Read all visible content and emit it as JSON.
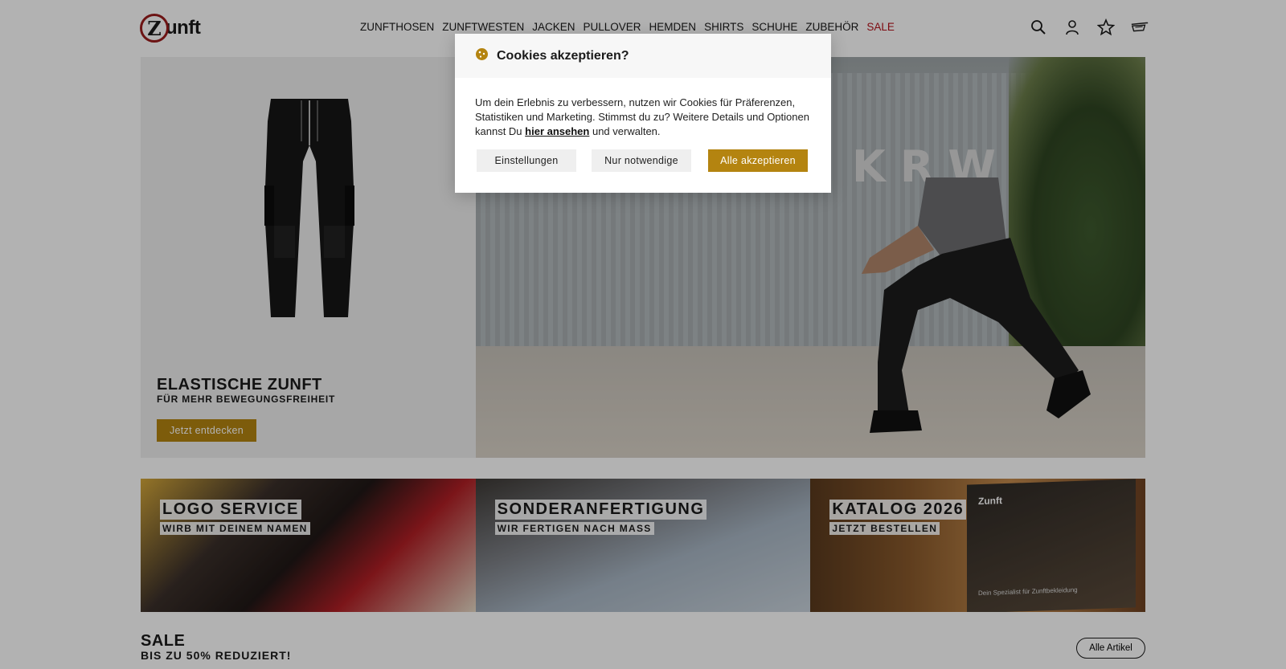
{
  "header": {
    "logo_letter": "Z",
    "logo_text": "unft",
    "nav": [
      "ZUNFTHOSEN",
      "ZUNFTWESTEN",
      "JACKEN",
      "PULLOVER",
      "HEMDEN",
      "SHIRTS",
      "SCHUHE",
      "ZUBEHÖR",
      "SALE"
    ],
    "icons": [
      "search-icon",
      "account-icon",
      "wishlist-icon",
      "cart-icon"
    ]
  },
  "hero": {
    "title": "ELASTISCHE ZUNFT",
    "subtitle": "FÜR MEHR BEWEGUNGSFREIHEIT",
    "button": "Jetzt entdecken",
    "building_text": "KRW"
  },
  "tiles": [
    {
      "title": "LOGO SERVICE",
      "subtitle": "WIRB MIT DEINEM NAMEN"
    },
    {
      "title": "SONDERANFERTIGUNG",
      "subtitle": "WIR FERTIGEN NACH MASS"
    },
    {
      "title": "KATALOG 2026",
      "subtitle": "JETZT BESTELLEN",
      "catalog_logo": "Zunft",
      "catalog_footer": "Dein Spezialist für Zunftbekleidung"
    }
  ],
  "sale": {
    "title": "SALE",
    "subtitle": "BIS ZU 50% REDUZIERT!",
    "button": "Alle Artikel"
  },
  "cookie": {
    "title": "Cookies akzeptieren?",
    "text_before": "Um dein Erlebnis zu verbessern, nutzen wir Cookies für Präferenzen, Statistiken und Marketing. Stimmst du zu? Weitere Details und Optionen kannst Du ",
    "link": "hier ansehen",
    "text_after": " und verwalten.",
    "btn_settings": "Einstellungen",
    "btn_necessary": "Nur notwendige",
    "btn_accept": "Alle akzeptieren"
  },
  "colors": {
    "accent_gold": "#b48410",
    "sale_red": "#b5121b",
    "logo_red": "#9b1c1c"
  }
}
